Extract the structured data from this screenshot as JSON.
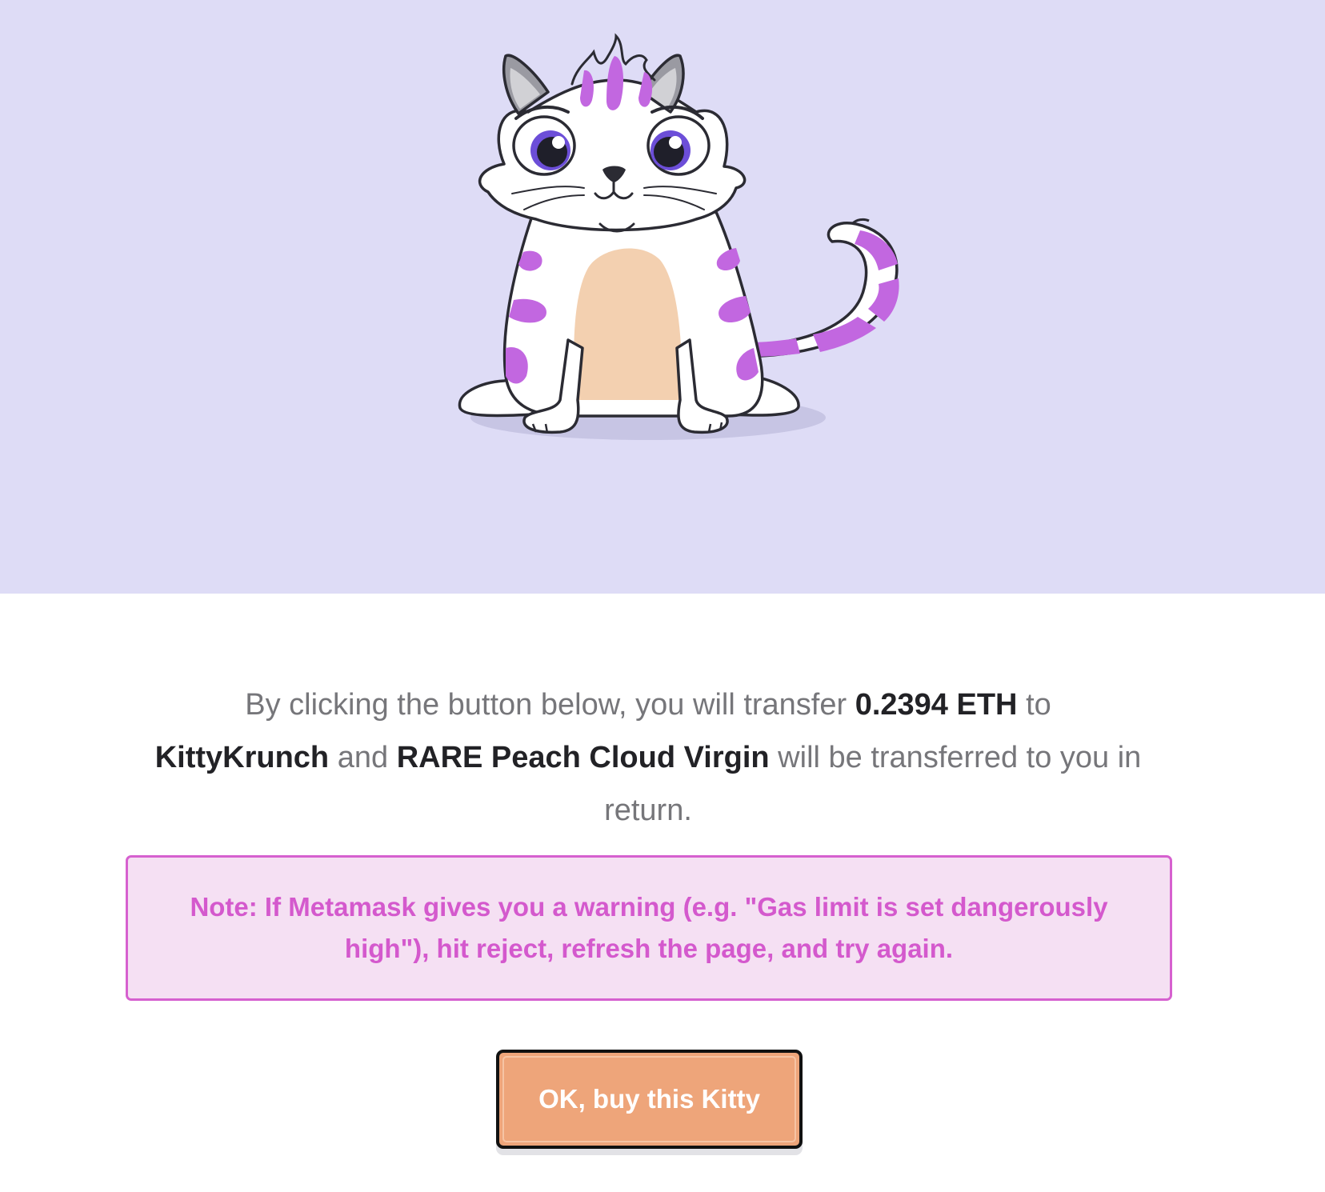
{
  "hero": {
    "illustration": "cryptokitty-purple-striped-cat",
    "background_color": "#dedcf6"
  },
  "message": {
    "part1": "By clicking the button below, you will transfer ",
    "price": "0.2394 ETH",
    "part2": " to ",
    "seller": "KittyKrunch",
    "part3": " and ",
    "kitty_name": "RARE Peach Cloud Virgin",
    "part4": " will be transferred to you in return."
  },
  "note": {
    "text": "Note: If Metamask gives you a warning (e.g. \"Gas limit is set dangerously high\"), hit reject, refresh the page, and try again.",
    "text_color": "#d459cd",
    "border_color": "#d660cf",
    "background_color": "#f5e0f3"
  },
  "buy_button": {
    "label": "OK, buy this Kitty",
    "background_color": "#eea57a"
  },
  "colors": {
    "stripe_purple": "#c267e0",
    "belly_peach": "#f3d0b0",
    "eye_purple": "#6c4ed8",
    "outline": "#2b2b33"
  }
}
